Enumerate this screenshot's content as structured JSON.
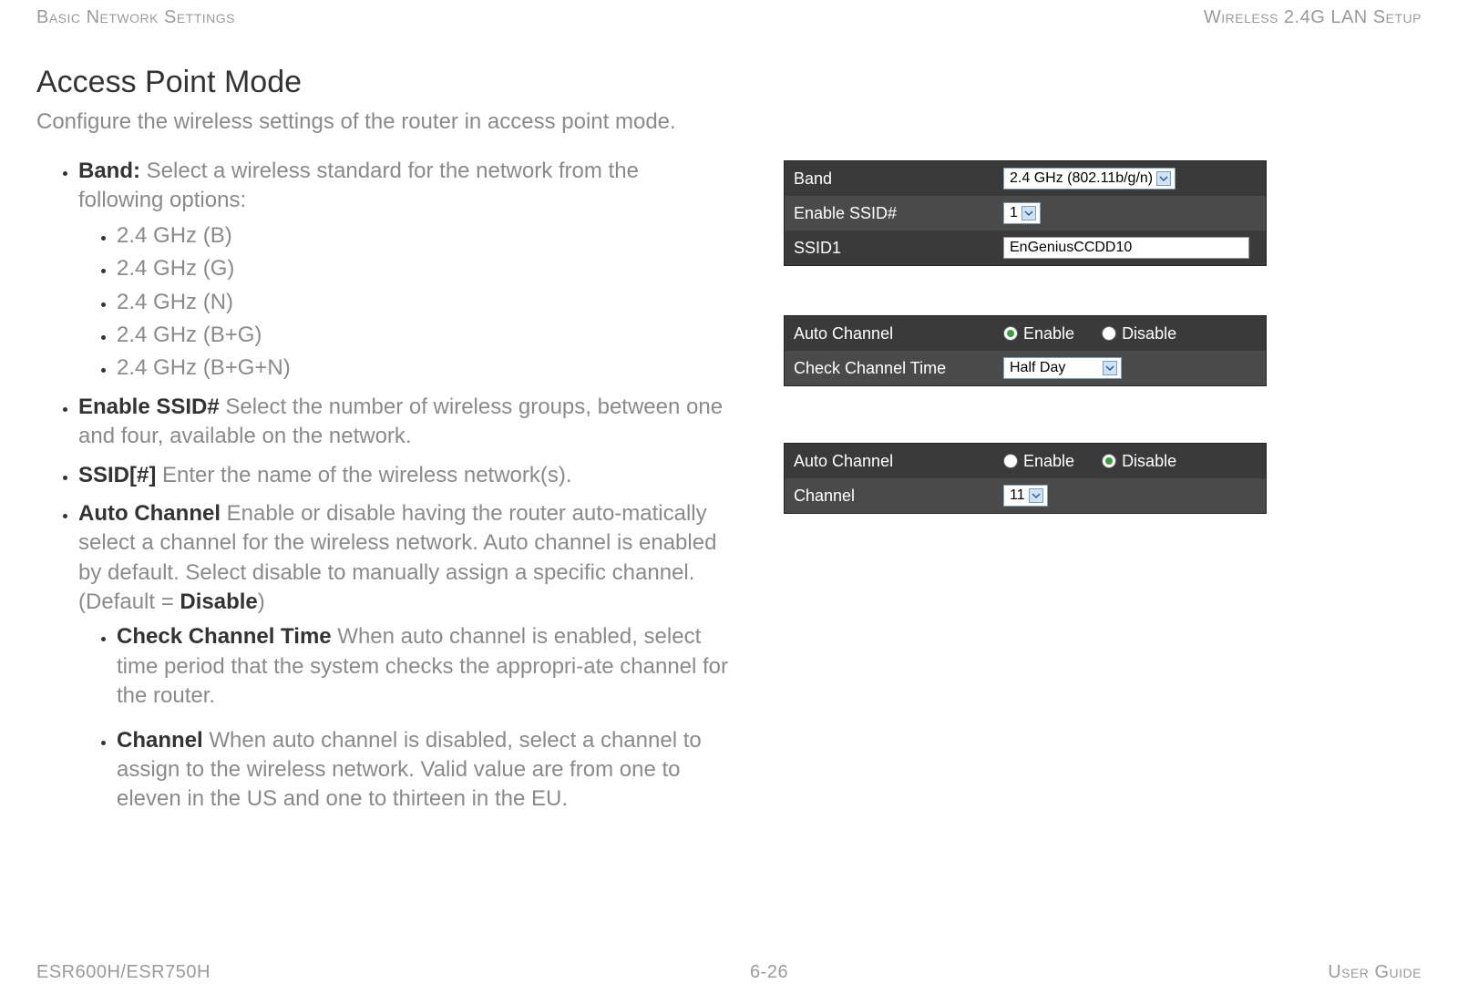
{
  "header": {
    "left": "Basic Network Settings",
    "right": "Wireless 2.4G LAN Setup"
  },
  "title": "Access Point Mode",
  "subtitle": "Configure the wireless settings of the router in access point mode.",
  "bullets": {
    "band_label": "Band:",
    "band_text": " Select a wireless standard for the network from the following options:",
    "band_opts": [
      "2.4 GHz (B)",
      "2.4 GHz (G)",
      "2.4 GHz (N)",
      "2.4 GHz (B+G)",
      "2.4 GHz (B+G+N)"
    ],
    "enable_ssid_label": "Enable SSID#",
    "enable_ssid_text": "  Select the number of wireless groups, between one and four, available on the network.",
    "ssid_label": "SSID[#]",
    "ssid_text": "  Enter the name of the wireless network(s).",
    "auto_ch_label": "Auto Channel",
    "auto_ch_text_1": "  Enable or disable having the router auto-matically select a channel for the wireless network. Auto channel is enabled by default. Select disable to manually assign a specific channel. (Default = ",
    "auto_ch_default": "Disable",
    "auto_ch_text_2": ")",
    "cct_label": "Check Channel Time",
    "cct_text": "  When auto channel is enabled, select time period that the system checks the appropri-ate channel for the router.",
    "ch_label": "Channel",
    "ch_text": " When auto channel is disabled, select a channel to assign to the wireless network. Valid value are from one to eleven in the US and one to thirteen in the EU."
  },
  "panel1": {
    "band_label": "Band",
    "band_value": "2.4 GHz (802.11b/g/n)",
    "essid_label": "Enable SSID#",
    "essid_value": "1",
    "ssid_label": "SSID1",
    "ssid_value": "EnGeniusCCDD10"
  },
  "panel2": {
    "ac_label": "Auto Channel",
    "enable": "Enable",
    "disable": "Disable",
    "cct_label": "Check Channel Time",
    "cct_value": "Half Day"
  },
  "panel3": {
    "ac_label": "Auto Channel",
    "enable": "Enable",
    "disable": "Disable",
    "ch_label": "Channel",
    "ch_value": "11"
  },
  "footer": {
    "left": "ESR600H/ESR750H",
    "center": "6-26",
    "right": "User Guide"
  }
}
